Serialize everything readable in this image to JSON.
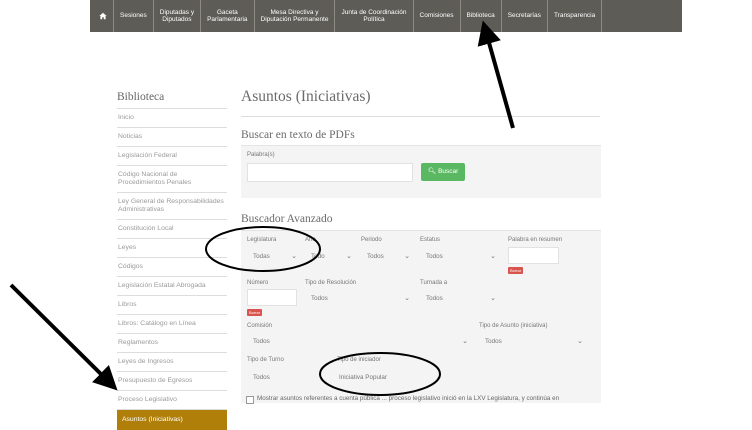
{
  "topnav": {
    "items": [
      "Sesiones",
      "Diputadas y\nDiputados",
      "Gaceta\nParlamentaria",
      "Mesa Directiva y\nDiputación Permanente",
      "Junta de Coordinación\nPolítica",
      "Comisiones",
      "Biblioteca",
      "Secretarías",
      "Transparencia"
    ]
  },
  "sidebar": {
    "title": "Biblioteca",
    "items": [
      "Inicio",
      "Noticias",
      "Legislación Federal",
      "Código Nacional de Procedimientos Penales",
      "Ley General de Responsabilidades Administrativas",
      "Constitución Local",
      "Leyes",
      "Códigos",
      "Legislación Estatal Abrogada",
      "Libros",
      "Libros: Catálogo en Línea",
      "Reglamentos",
      "Leyes de Ingresos",
      "Presupuesto de Egresos",
      "Proceso Legislativo",
      "Asuntos (Iniciativas)"
    ]
  },
  "page": {
    "title": "Asuntos (Iniciativas)",
    "pdf_search": {
      "heading": "Buscar en texto de PDFs",
      "label": "Palabra(s)",
      "button": "Buscar"
    },
    "advanced": {
      "heading": "Buscador Avanzado",
      "legislatura_label": "Legislatura",
      "legislatura_value": "Todas",
      "anio_label": "Año",
      "anio_value": "Todo",
      "periodo_label": "Periodo",
      "periodo_value": "Todos",
      "estatus_label": "Estatus",
      "estatus_value": "Todos",
      "palabra_label": "Palabra en resumen",
      "borrar": "Borrar",
      "numero_label": "Número",
      "tipo_resolucion_label": "Tipo de Resolución",
      "tipo_resolucion_value": "Todos",
      "turnada_label": "Turnada a",
      "turnada_value": "Todos",
      "comision_label": "Comisión",
      "comision_value": "Todos",
      "tipo_asunto_label": "Tipo de Asunto (iniciativa)",
      "tipo_asunto_value": "Todos",
      "tipo_turno_label": "Tipo de Turno",
      "tipo_turno_value": "Todos",
      "tipo_iniciador_label": "Tipo de iniciador",
      "tipo_iniciador_value": "Iniciativa Popular",
      "checkbox_text": "Mostrar asuntos referentes a cuenta pública ... proceso legislativo inició en la LXV Legislatura, y continúa en"
    }
  }
}
